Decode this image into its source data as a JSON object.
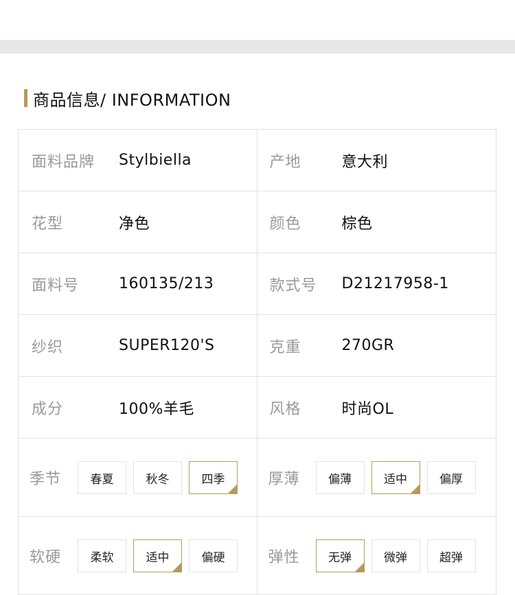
{
  "section": {
    "title": "商品信息/ INFORMATION",
    "accent_color": "#b59a5b"
  },
  "rows": [
    {
      "left": {
        "label": "面料品牌",
        "value": "Stylbiella"
      },
      "right": {
        "label": "产地",
        "value": "意大利"
      }
    },
    {
      "left": {
        "label": "花型",
        "value": "净色"
      },
      "right": {
        "label": "颜色",
        "value": "棕色"
      }
    },
    {
      "left": {
        "label": "面料号",
        "value": "160135/213"
      },
      "right": {
        "label": "款式号",
        "value": "D21217958-1"
      }
    },
    {
      "left": {
        "label": "纱织",
        "value": "SUPER120'S"
      },
      "right": {
        "label": "克重",
        "value": "270GR"
      }
    },
    {
      "left": {
        "label": "成分",
        "value": "100%羊毛"
      },
      "right": {
        "label": "风格",
        "value": "时尚OL"
      }
    }
  ],
  "tag_rows": [
    {
      "left": {
        "label": "季节",
        "options": [
          "春夏",
          "秋冬",
          "四季"
        ],
        "selected": "四季"
      },
      "right": {
        "label": "厚薄",
        "options": [
          "偏薄",
          "适中",
          "偏厚"
        ],
        "selected": "适中"
      }
    },
    {
      "left": {
        "label": "软硬",
        "options": [
          "柔软",
          "适中",
          "偏硬"
        ],
        "selected": "适中"
      },
      "right": {
        "label": "弹性",
        "options": [
          "无弹",
          "微弹",
          "超弹"
        ],
        "selected": "无弹"
      }
    }
  ]
}
